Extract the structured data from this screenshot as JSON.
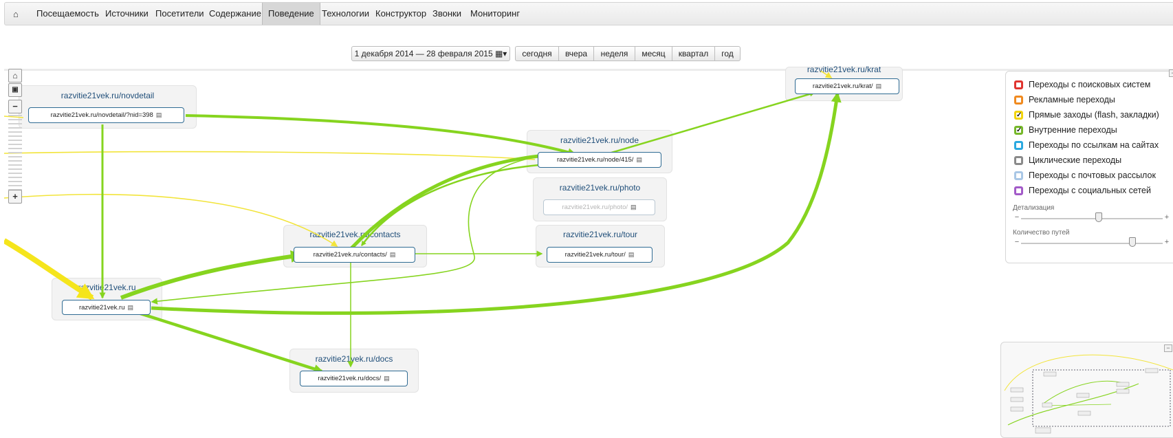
{
  "nav": {
    "home_icon": "home-icon",
    "items": [
      {
        "label": "Посещаемость"
      },
      {
        "label": "Источники"
      },
      {
        "label": "Посетители"
      },
      {
        "label": "Содержание"
      },
      {
        "label": "Поведение",
        "active": true
      },
      {
        "label": "Технологии"
      },
      {
        "label": "Конструктор"
      },
      {
        "label": "Звонки"
      },
      {
        "label": "Мониторинг"
      }
    ]
  },
  "date": {
    "range": "1 декабря 2014 — 28 февраля 2015",
    "calendar_icon": "calendar-icon",
    "periods": [
      "сегодня",
      "вчера",
      "неделя",
      "месяц",
      "квартал",
      "год"
    ]
  },
  "graph": {
    "groups": [
      {
        "title": "razvitie21vek.ru/novdetail",
        "node": "razvitie21vek.ru/novdetail/?nid=398"
      },
      {
        "title": "razvitie21vek.ru/node",
        "node": "razvitie21vek.ru/node/415/"
      },
      {
        "title": "razvitie21vek.ru/photo",
        "node": "razvitie21vek.ru/photo/",
        "dim": true
      },
      {
        "title": "razvitie21vek.ru/contacts",
        "node": "razvitie21vek.ru/contacts/"
      },
      {
        "title": "razvitie21vek.ru/tour",
        "node": "razvitie21vek.ru/tour/"
      },
      {
        "title": "razvitie21vek.ru",
        "node": "razvitie21vek.ru"
      },
      {
        "title": "razvitie21vek.ru/docs",
        "node": "razvitie21vek.ru/docs/"
      },
      {
        "title": "razvitie21vek.ru/krat",
        "node": "razvitie21vek.ru/krat/"
      }
    ],
    "external_icon": "external-link-icon",
    "edge_colors": {
      "direct": "#f5e51c",
      "direct_light": "#f2e43a",
      "internal": "#86d41f"
    }
  },
  "legend": {
    "items": [
      {
        "label": "Переходы с поисковых систем",
        "color": "#e0342f",
        "checked": false
      },
      {
        "label": "Рекламные переходы",
        "color": "#f08a1f",
        "checked": false
      },
      {
        "label": "Прямые заходы (flash, закладки)",
        "color": "#f2d40c",
        "checked": true
      },
      {
        "label": "Внутренние переходы",
        "color": "#76b82a",
        "checked": true
      },
      {
        "label": "Переходы по ссылкам на сайтах",
        "color": "#2aa9e0",
        "checked": false
      },
      {
        "label": "Циклические переходы",
        "color": "#8a8a8a",
        "checked": false
      },
      {
        "label": "Переходы с почтовых рассылок",
        "color": "#a9c7e6",
        "checked": false
      },
      {
        "label": "Переходы с социальных сетей",
        "color": "#a25ac8",
        "checked": false
      }
    ],
    "detail_label": "Детализация",
    "detail_value": 0.55,
    "paths_label": "Количество путей",
    "paths_value": 0.8
  }
}
